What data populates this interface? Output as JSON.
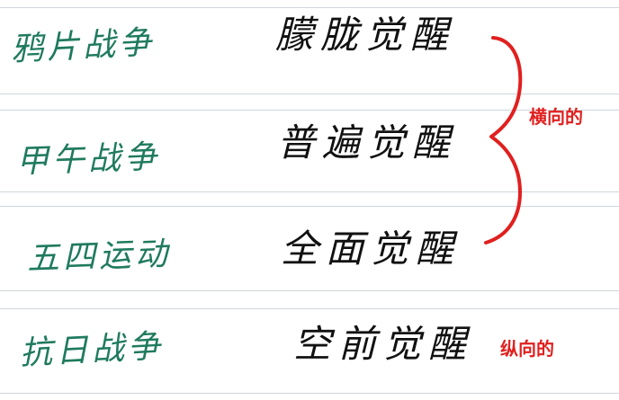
{
  "notes_page": {
    "rows": [
      {
        "event": "鸦片战争",
        "awakening": "朦胧觉醒"
      },
      {
        "event": "甲午战争",
        "awakening": "普遍觉醒"
      },
      {
        "event": "五四运动",
        "awakening": "全面觉醒"
      },
      {
        "event": "抗日战争",
        "awakening": "空前觉醒"
      }
    ],
    "annotations": {
      "horizontal": "横向的",
      "vertical": "纵向的"
    },
    "colors": {
      "event_ink": "#1f7a5e",
      "awakening_ink": "#111111",
      "annotation_ink": "#e0201f",
      "rule_lines": "#cfd6dc",
      "background": "#ffffff"
    }
  }
}
